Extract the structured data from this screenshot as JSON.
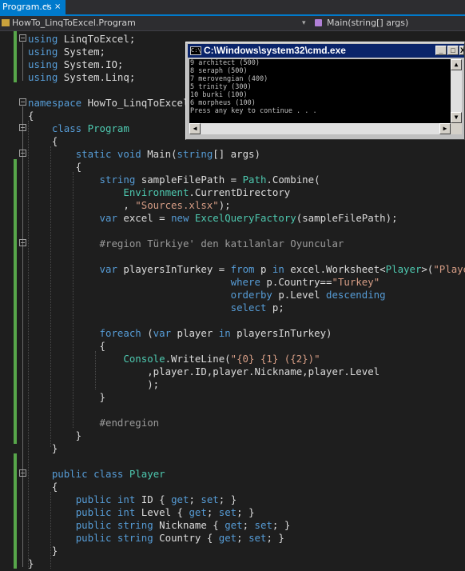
{
  "tab": {
    "title": "Program.cs",
    "pin": "⊣",
    "close": "×"
  },
  "nav": {
    "left": "HowTo_LinqToExcel.Program",
    "left_dropdown": "▾",
    "right": "Main(string[] args)"
  },
  "code_lines": [
    [
      [
        "kw",
        "using"
      ],
      [
        "pl",
        " LinqToExcel;"
      ]
    ],
    [
      [
        "kw",
        "using"
      ],
      [
        "pl",
        " System;"
      ]
    ],
    [
      [
        "kw",
        "using"
      ],
      [
        "pl",
        " System.IO;"
      ]
    ],
    [
      [
        "kw",
        "using"
      ],
      [
        "pl",
        " System.Linq;"
      ]
    ],
    [],
    [
      [
        "kw",
        "namespace"
      ],
      [
        "pl",
        " HowTo_LinqToExcel"
      ]
    ],
    [
      [
        "pl",
        "{"
      ]
    ],
    [
      [
        "pl",
        "    "
      ],
      [
        "kw",
        "class"
      ],
      [
        "pl",
        " "
      ],
      [
        "ty",
        "Program"
      ]
    ],
    [
      [
        "pl",
        "    {"
      ]
    ],
    [
      [
        "pl",
        "        "
      ],
      [
        "kw",
        "static"
      ],
      [
        "pl",
        " "
      ],
      [
        "kw",
        "void"
      ],
      [
        "pl",
        " Main("
      ],
      [
        "kw",
        "string"
      ],
      [
        "pl",
        "[] args)"
      ]
    ],
    [
      [
        "pl",
        "        {"
      ]
    ],
    [
      [
        "pl",
        "            "
      ],
      [
        "kw",
        "string"
      ],
      [
        "pl",
        " sampleFilePath = "
      ],
      [
        "ty",
        "Path"
      ],
      [
        "pl",
        ".Combine("
      ]
    ],
    [
      [
        "pl",
        "                "
      ],
      [
        "ty",
        "Environment"
      ],
      [
        "pl",
        ".CurrentDirectory"
      ]
    ],
    [
      [
        "pl",
        "                , "
      ],
      [
        "st",
        "\"Sources.xlsx\""
      ],
      [
        "pl",
        ");"
      ]
    ],
    [
      [
        "pl",
        "            "
      ],
      [
        "kw",
        "var"
      ],
      [
        "pl",
        " excel = "
      ],
      [
        "kw",
        "new"
      ],
      [
        "pl",
        " "
      ],
      [
        "ty",
        "ExcelQueryFactory"
      ],
      [
        "pl",
        "(sampleFilePath);"
      ]
    ],
    [],
    [
      [
        "pl",
        "            "
      ],
      [
        "rg",
        "#region Türkiye' den katılanlar Oyuncular"
      ]
    ],
    [],
    [
      [
        "pl",
        "            "
      ],
      [
        "kw",
        "var"
      ],
      [
        "pl",
        " playersInTurkey = "
      ],
      [
        "kw",
        "from"
      ],
      [
        "pl",
        " p "
      ],
      [
        "kw",
        "in"
      ],
      [
        "pl",
        " excel.Worksheet<"
      ],
      [
        "ty",
        "Player"
      ],
      [
        "pl",
        ">("
      ],
      [
        "st",
        "\"Player\""
      ],
      [
        "pl",
        ")"
      ]
    ],
    [
      [
        "pl",
        "                                  "
      ],
      [
        "kw",
        "where"
      ],
      [
        "pl",
        " p.Country=="
      ],
      [
        "st",
        "\"Turkey\""
      ]
    ],
    [
      [
        "pl",
        "                                  "
      ],
      [
        "kw",
        "orderby"
      ],
      [
        "pl",
        " p.Level "
      ],
      [
        "kw",
        "descending"
      ]
    ],
    [
      [
        "pl",
        "                                  "
      ],
      [
        "kw",
        "select"
      ],
      [
        "pl",
        " p;"
      ]
    ],
    [],
    [
      [
        "pl",
        "            "
      ],
      [
        "kw",
        "foreach"
      ],
      [
        "pl",
        " ("
      ],
      [
        "kw",
        "var"
      ],
      [
        "pl",
        " player "
      ],
      [
        "kw",
        "in"
      ],
      [
        "pl",
        " playersInTurkey)"
      ]
    ],
    [
      [
        "pl",
        "            {"
      ]
    ],
    [
      [
        "pl",
        "                "
      ],
      [
        "ty",
        "Console"
      ],
      [
        "pl",
        ".WriteLine("
      ],
      [
        "st",
        "\"{0} {1} ({2})\""
      ]
    ],
    [
      [
        "pl",
        "                    ,player.ID,player.Nickname,player.Level"
      ]
    ],
    [
      [
        "pl",
        "                    );"
      ]
    ],
    [
      [
        "pl",
        "            }"
      ]
    ],
    [],
    [
      [
        "pl",
        "            "
      ],
      [
        "rg",
        "#endregion"
      ]
    ],
    [
      [
        "pl",
        "        }"
      ]
    ],
    [
      [
        "pl",
        "    }"
      ]
    ],
    [],
    [
      [
        "pl",
        "    "
      ],
      [
        "kw",
        "public"
      ],
      [
        "pl",
        " "
      ],
      [
        "kw",
        "class"
      ],
      [
        "pl",
        " "
      ],
      [
        "ty",
        "Player"
      ]
    ],
    [
      [
        "pl",
        "    {"
      ]
    ],
    [
      [
        "pl",
        "        "
      ],
      [
        "kw",
        "public"
      ],
      [
        "pl",
        " "
      ],
      [
        "kw",
        "int"
      ],
      [
        "pl",
        " ID { "
      ],
      [
        "kw",
        "get"
      ],
      [
        "pl",
        "; "
      ],
      [
        "kw",
        "set"
      ],
      [
        "pl",
        "; }"
      ]
    ],
    [
      [
        "pl",
        "        "
      ],
      [
        "kw",
        "public"
      ],
      [
        "pl",
        " "
      ],
      [
        "kw",
        "int"
      ],
      [
        "pl",
        " Level { "
      ],
      [
        "kw",
        "get"
      ],
      [
        "pl",
        "; "
      ],
      [
        "kw",
        "set"
      ],
      [
        "pl",
        "; }"
      ]
    ],
    [
      [
        "pl",
        "        "
      ],
      [
        "kw",
        "public"
      ],
      [
        "pl",
        " "
      ],
      [
        "kw",
        "string"
      ],
      [
        "pl",
        " Nickname { "
      ],
      [
        "kw",
        "get"
      ],
      [
        "pl",
        "; "
      ],
      [
        "kw",
        "set"
      ],
      [
        "pl",
        "; }"
      ]
    ],
    [
      [
        "pl",
        "        "
      ],
      [
        "kw",
        "public"
      ],
      [
        "pl",
        " "
      ],
      [
        "kw",
        "string"
      ],
      [
        "pl",
        " Country { "
      ],
      [
        "kw",
        "get"
      ],
      [
        "pl",
        "; "
      ],
      [
        "kw",
        "set"
      ],
      [
        "pl",
        "; }"
      ]
    ],
    [
      [
        "pl",
        "    }"
      ]
    ],
    [
      [
        "pl",
        "}"
      ]
    ]
  ],
  "colors": {
    "kw": "#569cd6",
    "ty": "#4ec9b0",
    "st": "#d69d85",
    "rg": "#9b9b9b",
    "pl": "#dcdcdc"
  },
  "cmd": {
    "title": "C:\\Windows\\system32\\cmd.exe",
    "icon_text": "C:\\",
    "minimize": "_",
    "maximize": "□",
    "close": "X",
    "scroll_up": "▲",
    "scroll_down": "▼",
    "scroll_left": "◀",
    "scroll_right": "▶",
    "output": [
      "9 architect (500)",
      "8 seraph (500)",
      "7 merovengian (400)",
      "5 trinity (300)",
      "10 burki (100)",
      "6 morpheus (100)",
      "Press any key to continue . . ."
    ]
  }
}
